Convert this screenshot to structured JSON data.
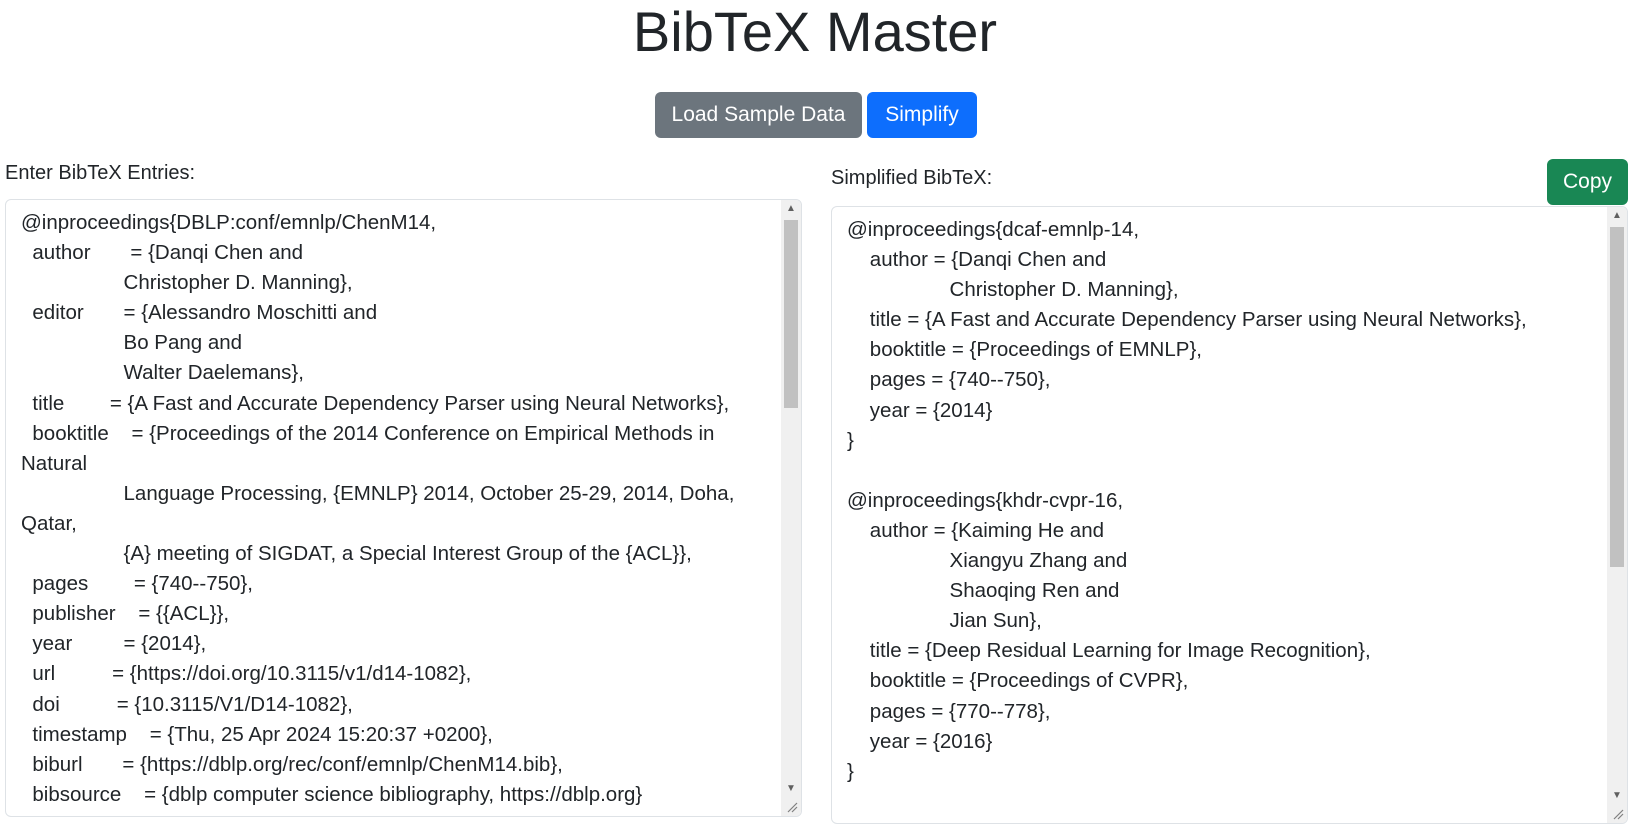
{
  "app": {
    "title": "BibTeX Master"
  },
  "toolbar": {
    "load_label": "Load Sample Data",
    "simplify_label": "Simplify"
  },
  "input": {
    "label": "Enter BibTeX Entries:",
    "value": "@inproceedings{DBLP:conf/emnlp/ChenM14,\n  author       = {Danqi Chen and\n                  Christopher D. Manning},\n  editor       = {Alessandro Moschitti and\n                  Bo Pang and\n                  Walter Daelemans},\n  title        = {A Fast and Accurate Dependency Parser using Neural Networks},\n  booktitle    = {Proceedings of the 2014 Conference on Empirical Methods in Natural\n                  Language Processing, {EMNLP} 2014, October 25-29, 2014, Doha, Qatar,\n                  {A} meeting of SIGDAT, a Special Interest Group of the {ACL}},\n  pages        = {740--750},\n  publisher    = {{ACL}},\n  year         = {2014},\n  url          = {https://doi.org/10.3115/v1/d14-1082},\n  doi          = {10.3115/V1/D14-1082},\n  timestamp    = {Thu, 25 Apr 2024 15:20:37 +0200},\n  biburl       = {https://dblp.org/rec/conf/emnlp/ChenM14.bib},\n  bibsource    = {dblp computer science bibliography, https://dblp.org}"
  },
  "output": {
    "label": "Simplified BibTeX:",
    "copy_label": "Copy",
    "value": "@inproceedings{dcaf-emnlp-14,\n    author = {Danqi Chen and\n                  Christopher D. Manning},\n    title = {A Fast and Accurate Dependency Parser using Neural Networks},\n    booktitle = {Proceedings of EMNLP},\n    pages = {740--750},\n    year = {2014}\n}\n\n@inproceedings{khdr-cvpr-16,\n    author = {Kaiming He and\n                  Xiangyu Zhang and\n                  Shaoqing Ren and\n                  Jian Sun},\n    title = {Deep Residual Learning for Image Recognition},\n    booktitle = {Proceedings of CVPR},\n    pages = {770--778},\n    year = {2016}\n}\n\n@inproceedings{"
  },
  "icons": {
    "scroll_up": "triangle-up-icon",
    "scroll_down": "triangle-down-icon",
    "resize": "resize-grip-icon"
  }
}
